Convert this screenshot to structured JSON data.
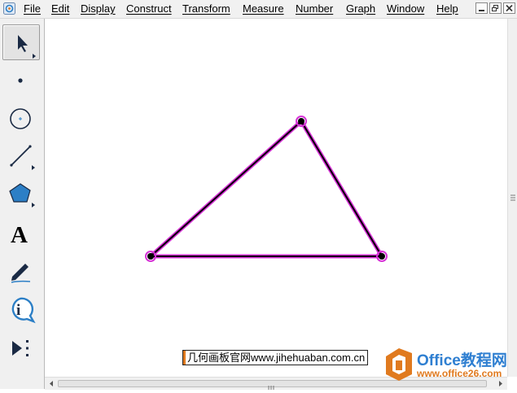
{
  "menubar": {
    "items": [
      {
        "label": "File"
      },
      {
        "label": "Edit"
      },
      {
        "label": "Display"
      },
      {
        "label": "Construct"
      },
      {
        "label": "Transform"
      },
      {
        "label": "Measure"
      },
      {
        "label": "Number"
      },
      {
        "label": "Graph"
      },
      {
        "label": "Window"
      },
      {
        "label": "Help"
      }
    ],
    "window_buttons": [
      "minimize",
      "restore",
      "close"
    ]
  },
  "toolbox": {
    "tools": [
      {
        "name": "arrow-selection-tool",
        "icon": "arrow-cursor-icon",
        "active": true
      },
      {
        "name": "point-tool",
        "icon": "point-icon"
      },
      {
        "name": "compass-tool",
        "icon": "circle-icon"
      },
      {
        "name": "straightedge-tool",
        "icon": "line-segment-icon"
      },
      {
        "name": "polygon-tool",
        "icon": "pentagon-icon"
      },
      {
        "name": "text-tool",
        "icon": "letter-a-icon",
        "label": "A"
      },
      {
        "name": "marker-tool",
        "icon": "pen-icon"
      },
      {
        "name": "information-tool",
        "icon": "info-icon",
        "label": "i"
      },
      {
        "name": "custom-tools",
        "icon": "play-dots-icon"
      }
    ]
  },
  "sketch": {
    "shape": "triangle",
    "highlight_color": "#d633d6",
    "point_color": "#000000"
  },
  "watermarks": {
    "site_text": "几何画板官网www.jihehuaban.com.cn",
    "office_title": "Office教程网",
    "office_url": "www.office26.com"
  },
  "colors": {
    "brand_orange": "#e07a1f",
    "brand_blue": "#2f7fd1",
    "tool_blue": "#2c7fc6"
  }
}
